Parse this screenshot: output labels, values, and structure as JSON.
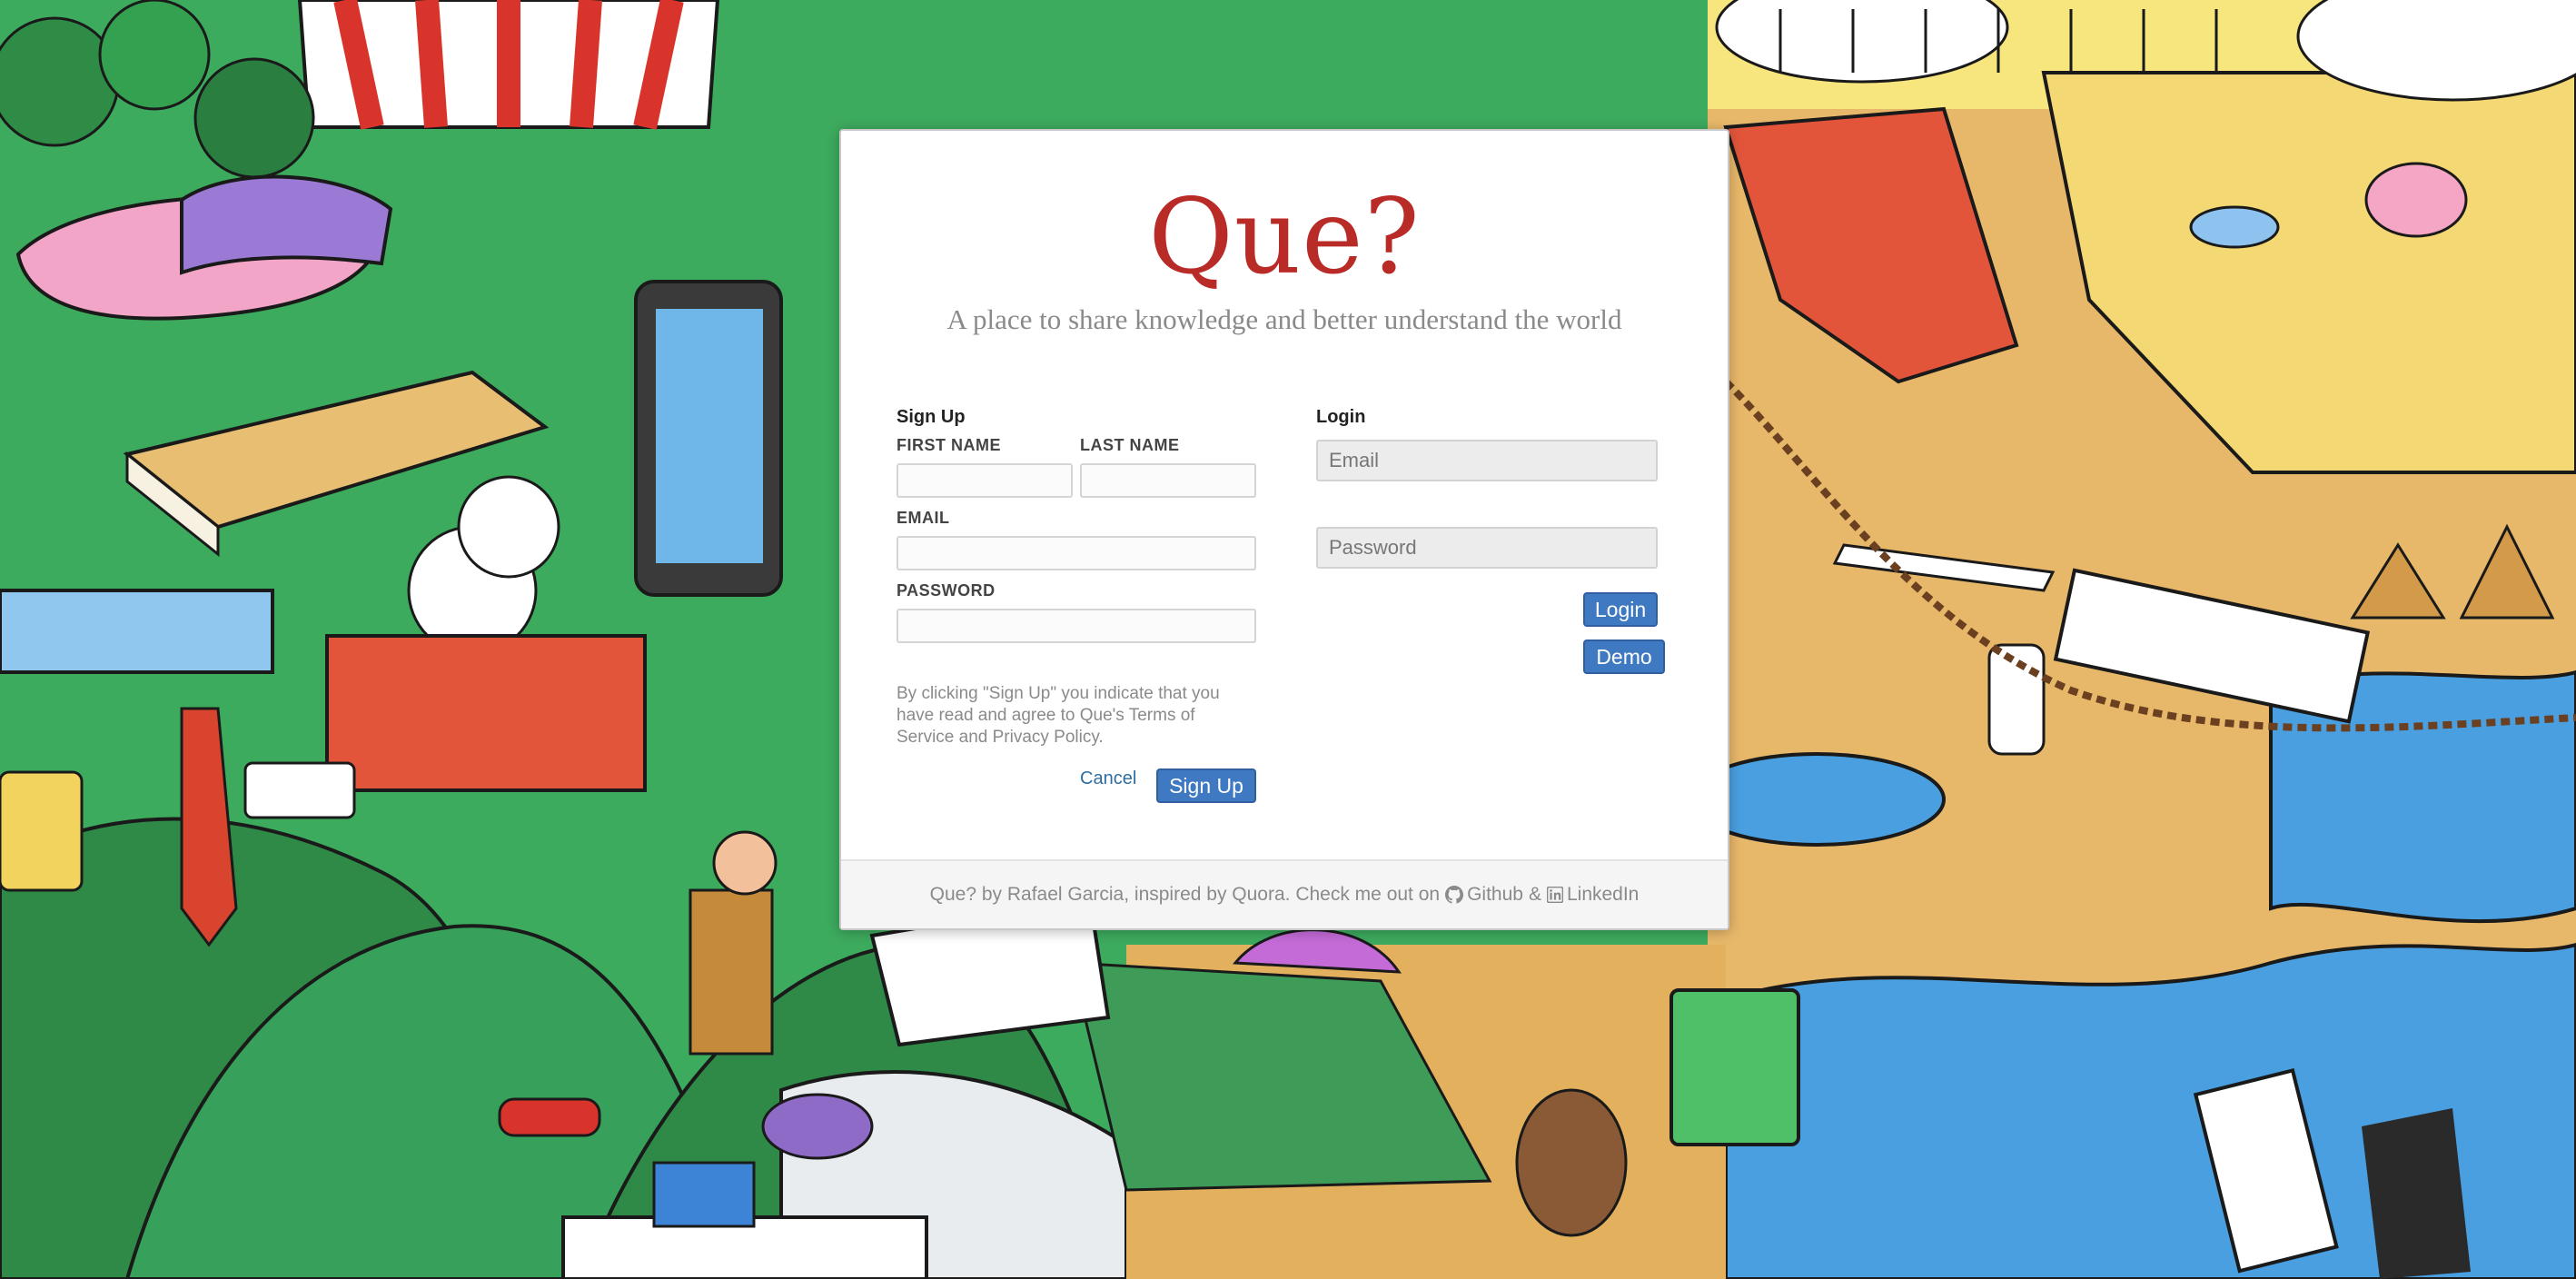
{
  "app": {
    "logo": "Que?",
    "tagline": "A place to share knowledge and better understand the world"
  },
  "signup": {
    "title": "Sign Up",
    "first_name_label": "FIRST NAME",
    "last_name_label": "LAST NAME",
    "email_label": "EMAIL",
    "password_label": "PASSWORD",
    "first_name_value": "",
    "last_name_value": "",
    "email_value": "",
    "password_value": "",
    "terms": "By clicking \"Sign Up\" you indicate that you have read and agree to Que's Terms of Service and Privacy Policy.",
    "cancel_label": "Cancel",
    "submit_label": "Sign Up"
  },
  "login": {
    "title": "Login",
    "email_placeholder": "Email",
    "password_placeholder": "Password",
    "login_label": "Login",
    "demo_label": "Demo"
  },
  "footer": {
    "text": "Que? by Rafael Garcia, inspired by Quora. Check me out on",
    "github_label": "Github",
    "separator": "&",
    "linkedin_label": "LinkedIn"
  },
  "colors": {
    "brand_red": "#b92b27",
    "button_blue": "#3f79c1",
    "link_blue": "#2e6da4"
  }
}
